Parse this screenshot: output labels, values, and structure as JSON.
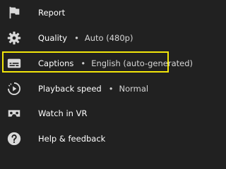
{
  "menu": {
    "items": [
      {
        "label": "Report",
        "icon": "flag-icon"
      },
      {
        "label": "Quality",
        "value": "Auto (480p)",
        "icon": "gear-icon"
      },
      {
        "label": "Captions",
        "value": "English (auto-generated)",
        "icon": "captions-icon"
      },
      {
        "label": "Playback speed",
        "value": "Normal",
        "icon": "playback-speed-icon"
      },
      {
        "label": "Watch in VR",
        "icon": "vr-headset-icon"
      },
      {
        "label": "Help & feedback",
        "icon": "help-icon"
      }
    ],
    "separator": "•"
  },
  "colors": {
    "background": "#212121",
    "text": "#ffffff",
    "icon": "#d9d9d9",
    "highlight": "#f2e60a"
  }
}
